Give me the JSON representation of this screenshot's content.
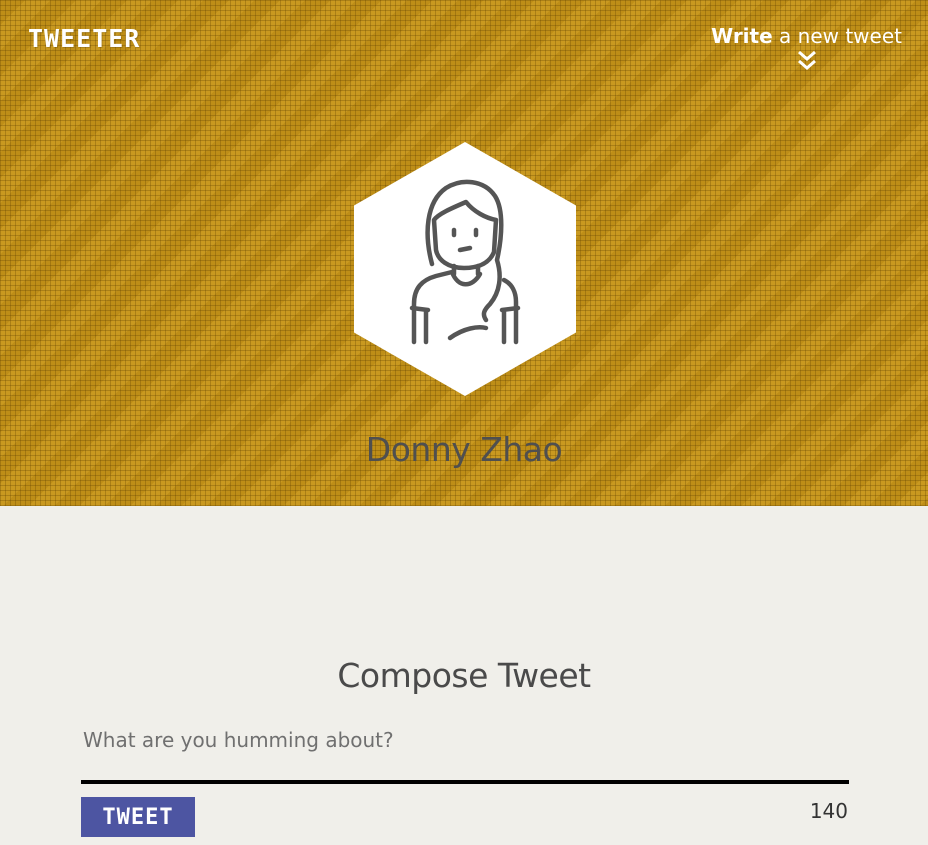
{
  "header": {
    "brand": "TWEETER",
    "new_tweet_first": "Write",
    "new_tweet_rest": " a new tweet",
    "icons": {
      "toggle": "double-chevron-down-icon",
      "avatar": "woman-avatar-icon"
    }
  },
  "profile": {
    "name": "Donny Zhao"
  },
  "compose": {
    "title": "Compose Tweet",
    "placeholder": "What are you humming about?",
    "value": "",
    "button_label": "TWEET",
    "counter": "140"
  },
  "colors": {
    "banner": "#c6951a",
    "button": "#4d55a2",
    "background": "#f0efea",
    "text": "#4f4f4f"
  }
}
